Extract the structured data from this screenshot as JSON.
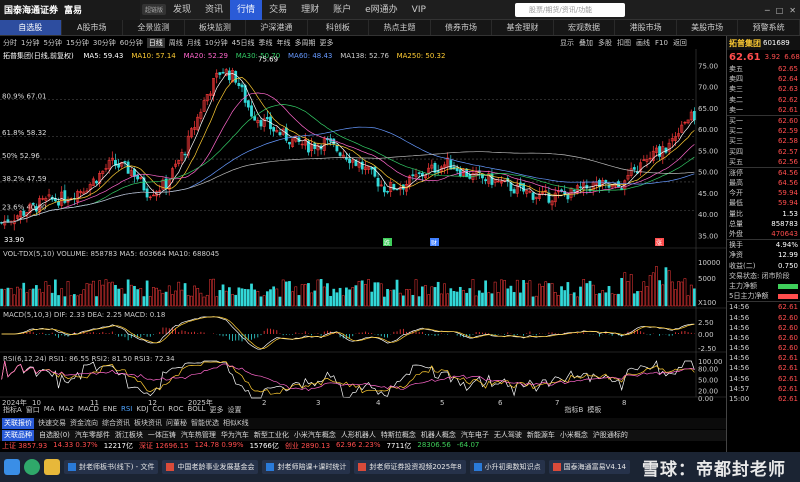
{
  "app": {
    "logo_text": "国泰海通证券",
    "logo_sub": "GUOTAI HAITONG SECURITIES",
    "brand2": "富易",
    "brand2_sub": "RICH EASY",
    "badge": "超链版"
  },
  "menu": [
    "发现",
    "资讯",
    "行情",
    "交易",
    "理财",
    "账户",
    "e网通办",
    "VIP"
  ],
  "menu_active": "行情",
  "search_placeholder": "股票/期货/资讯/功能",
  "tabs": [
    "自选股",
    "A股市场",
    "全景监测",
    "板块监测",
    "沪深港通",
    "科创板",
    "热点主题",
    "债券市场",
    "基金理财",
    "宏观数据",
    "港股市场",
    "美股市场",
    "预警系统"
  ],
  "tab_active": "自选股",
  "periods": [
    "分时",
    "1分钟",
    "5分钟",
    "15分钟",
    "30分钟",
    "60分钟",
    "日线",
    "周线",
    "月线",
    "10分钟",
    "45日线",
    "季线",
    "年线",
    "多周期",
    "更多"
  ],
  "period_active": "日线",
  "tools": [
    "显示",
    "叠加",
    "多股",
    "扣图",
    "画线",
    "F10",
    "返回"
  ],
  "legend_main": {
    "name": "拓普集团(日线,前复权)",
    "ma5": "MA5: 59.43",
    "ma10": "MA10: 57.14",
    "ma20": "MA20: 52.29",
    "ma30": "MA30: 50.70",
    "ma60": "MA60: 48.43",
    "ma138": "MA138: 52.76",
    "ma250": "MA250: 50.32"
  },
  "price_axis": [
    "75.00",
    "70.00",
    "65.00",
    "60.00",
    "55.00",
    "50.00",
    "45.00",
    "40.00",
    "35.00"
  ],
  "fib_labels": [
    "80.9% 67.01",
    "61.8% 58.32",
    "50% 52.96",
    "38.2% 47.59",
    "23.6% 40.90"
  ],
  "high_label": "75.69",
  "low_label": "33.90",
  "markers": [
    "跌",
    "财",
    "涨"
  ],
  "vol_legend": "VOL-TDX(5,10)  VOLUME: 858783  MA5: 603664  MA10: 688045",
  "vol_axis": [
    "10000",
    "5000",
    "X100"
  ],
  "macd_legend": "MACD(5,10,3)  DIF: 2.33  DEA: 2.25  MACD: 0.18",
  "macd_axis": [
    "2.50",
    "0.00",
    "-2.50"
  ],
  "rsi_legend": "RSI(6,12,24)  RSI1: 86.55  RSI2: 81.50  RSI3: 72.34",
  "rsi_axis": [
    "100.00",
    "80.00",
    "50.00",
    "20.00",
    "0.00"
  ],
  "date_axis": [
    "2024年",
    "10",
    "11",
    "12",
    "2025年",
    "2",
    "3",
    "4",
    "5",
    "6",
    "7",
    "8"
  ],
  "indicator_tabs": [
    "指标A",
    "窗口",
    "MA",
    "MA2",
    "MACD",
    "ENE",
    "RSI",
    "KDJ",
    "CCI",
    "ROC",
    "BOLL",
    "更多",
    "设置"
  ],
  "indicator_active": "RSI",
  "indicator_right": [
    "指标B",
    "模板"
  ],
  "bottom_tabs": [
    "关联报价",
    "快速交易",
    "资金流向",
    "综合资讯",
    "板块资讯",
    "问董秘",
    "智能优选",
    "相似K线"
  ],
  "concepts": [
    "关联品种",
    "自选股(0)",
    "汽车零部件",
    "浙江板块",
    "一体压铸",
    "汽车热管理",
    "华为汽车",
    "新型工业化",
    "小米汽车概念",
    "人形机器人",
    "特斯拉概念",
    "机器人概念",
    "汽车电子",
    "无人驾驶",
    "新能源车",
    "小米概念",
    "沪股通标的"
  ],
  "ticker": [
    {
      "t": "上证 3857.93",
      "c": "up"
    },
    {
      "t": "14.33 0.37%",
      "c": "up"
    },
    {
      "t": "12217亿",
      "c": "wht"
    },
    {
      "t": "深证 12696.15",
      "c": "up"
    },
    {
      "t": "124.78 0.99%",
      "c": "up"
    },
    {
      "t": "15766亿",
      "c": "wht"
    },
    {
      "t": "创业 2890.13",
      "c": "up"
    },
    {
      "t": "62.96 2.23%",
      "c": "up"
    },
    {
      "t": "7711亿",
      "c": "wht"
    },
    {
      "t": "28306.56",
      "c": "dn"
    },
    {
      "t": "-64.07",
      "c": "dn"
    }
  ],
  "rp": {
    "name": "拓普集团",
    "code": "601689",
    "price": "62.61",
    "change": "3.92",
    "pct": "6.68%",
    "asks": [
      {
        "l": "卖五",
        "v": "62.65"
      },
      {
        "l": "卖四",
        "v": "62.64"
      },
      {
        "l": "卖三",
        "v": "62.63"
      },
      {
        "l": "卖二",
        "v": "62.62"
      },
      {
        "l": "卖一",
        "v": "62.61"
      }
    ],
    "bids": [
      {
        "l": "买一",
        "v": "62.60"
      },
      {
        "l": "买二",
        "v": "62.59"
      },
      {
        "l": "买三",
        "v": "62.58"
      },
      {
        "l": "买四",
        "v": "62.57"
      },
      {
        "l": "买五",
        "v": "62.56"
      }
    ],
    "stats": [
      {
        "l": "涨停",
        "v": "64.56",
        "c": "red"
      },
      {
        "l": "最高",
        "v": "64.56",
        "c": "red"
      },
      {
        "l": "今开",
        "v": "59.94",
        "c": "red"
      },
      {
        "l": "最低",
        "v": "59.94",
        "c": "red"
      },
      {
        "l": "量比",
        "v": "1.53",
        "c": "wht"
      },
      {
        "l": "总量",
        "v": "858783",
        "c": "wht"
      },
      {
        "l": "外盘",
        "v": "470643",
        "c": "red"
      }
    ],
    "stats2": [
      {
        "l": "换手",
        "v": "4.94%",
        "c": "wht"
      },
      {
        "l": "净资",
        "v": "12.99",
        "c": "wht"
      },
      {
        "l": "收益(二)",
        "v": "0.750",
        "c": "wht"
      }
    ],
    "status": "交易状态: 闭市阶段",
    "flows": [
      "主力净额",
      "5日主力净额"
    ],
    "ticks": [
      {
        "t": "14:56",
        "v": "62.61"
      },
      {
        "t": "14:56",
        "v": "62.60"
      },
      {
        "t": "14:56",
        "v": "62.60"
      },
      {
        "t": "14:56",
        "v": "62.60"
      },
      {
        "t": "14:56",
        "v": "62.60"
      },
      {
        "t": "14:56",
        "v": "62.61"
      },
      {
        "t": "14:56",
        "v": "62.61"
      },
      {
        "t": "14:56",
        "v": "62.61"
      },
      {
        "t": "14:57",
        "v": "62.61"
      },
      {
        "t": "15:00",
        "v": "62.61"
      }
    ]
  },
  "taskbar": {
    "items": [
      "封老师板书(线下) - 文件",
      "中国老龄事业发展基金会",
      "封老师陪课+课时统计",
      "封老师证券投资视频2025年8",
      "小升初奥数知识点",
      "国泰海通富易V4.14"
    ]
  },
  "watermark": "雪球：帝都封老师"
}
